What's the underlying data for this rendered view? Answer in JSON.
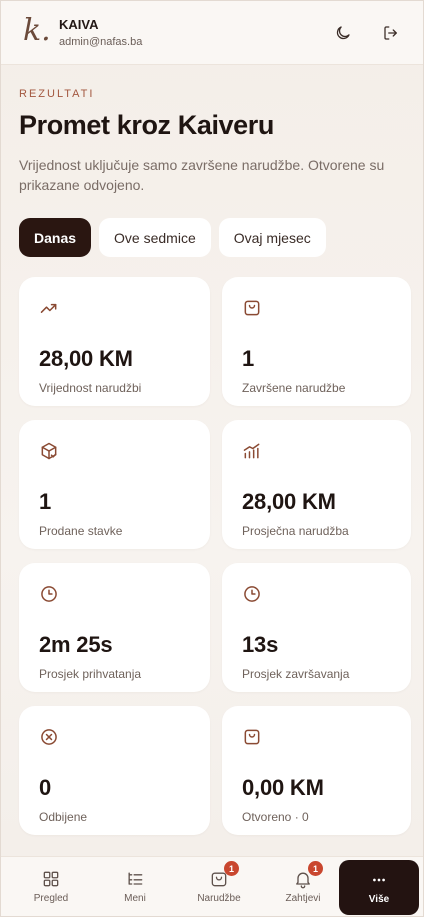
{
  "header": {
    "logo": "k.",
    "brand_name": "KAIVA",
    "email": "admin@nafas.ba",
    "theme_icon": "moon-icon",
    "logout_icon": "logout-icon"
  },
  "page": {
    "eyebrow": "REZULTATI",
    "title": "Promet kroz Kaiveru",
    "description": "Vrijednost uključuje samo završene narudžbe. Otvorene su prikazane odvojeno."
  },
  "tabs": [
    {
      "label": "Danas",
      "active": true
    },
    {
      "label": "Ove sedmice",
      "active": false
    },
    {
      "label": "Ovaj mjesec",
      "active": false
    }
  ],
  "stats": [
    {
      "icon": "trending-up-icon",
      "value": "28,00 KM",
      "label": "Vrijednost narudžbi"
    },
    {
      "icon": "shopping-bag-icon",
      "value": "1",
      "label": "Završene narudžbe"
    },
    {
      "icon": "package-check-icon",
      "value": "1",
      "label": "Prodane stavke"
    },
    {
      "icon": "bar-chart-trend-icon",
      "value": "28,00 KM",
      "label": "Prosječna narudžba"
    },
    {
      "icon": "clock-icon",
      "value": "2m 25s",
      "label": "Prosjek prihvatanja"
    },
    {
      "icon": "clock-icon",
      "value": "13s",
      "label": "Prosjek završavanja"
    },
    {
      "icon": "x-circle-icon",
      "value": "0",
      "label": "Odbijene"
    },
    {
      "icon": "shopping-bag-icon",
      "value": "0,00 KM",
      "label": "Otvoreno · 0"
    }
  ],
  "nav": [
    {
      "label": "Pregled",
      "icon": "grid-icon"
    },
    {
      "label": "Meni",
      "icon": "list-tree-icon"
    },
    {
      "label": "Narudžbe",
      "icon": "shopping-bag-icon",
      "badge": "1"
    },
    {
      "label": "Zahtjevi",
      "icon": "bell-icon",
      "badge": "1"
    },
    {
      "label": "Više",
      "icon": "more-dots-icon",
      "active": true
    }
  ],
  "colors": {
    "accent": "#a2573f",
    "dark": "#231311",
    "badge": "#c9472f",
    "icon": "#8a4a33"
  }
}
